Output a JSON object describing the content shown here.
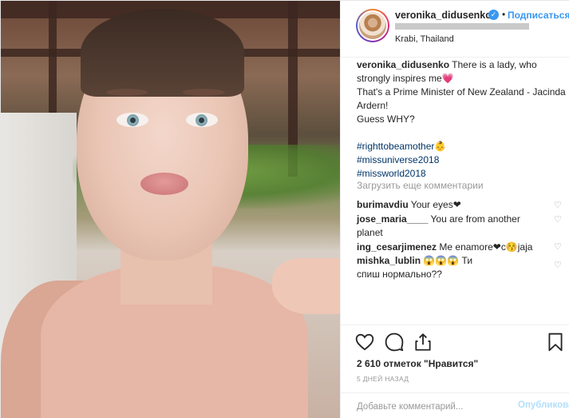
{
  "post": {
    "username": "veronika_didusenko",
    "follow_label": "Подписаться",
    "dot": "•",
    "location": "Krabi, Thailand",
    "caption": {
      "username": "veronika_didusenko",
      "text_line1": " There is a lady, who strongly inspires me💗",
      "text_line2": "That's a Prime Minister of New Zealand - Jacinda Ardern!",
      "text_line3": "Guess WHY?",
      "hashtags": [
        "#righttobeamother👶",
        "#missuniverse2018",
        "#missworld2018"
      ]
    },
    "load_more": "Загрузить еще комментарии",
    "comments": [
      {
        "username": "burimavdiu",
        "text": " Your eyes❤"
      },
      {
        "username": "jose_maria____",
        "text": " You are from another planet"
      },
      {
        "username": "ing_cesarjimenez",
        "text": " Me enamore❤c😚jaja"
      },
      {
        "username": "mishka_lublin",
        "text": " 😱😱😱 Ти спиш нормально??"
      }
    ],
    "likes_text": "2 610 отметок \"Нравится\"",
    "time_ago": "5 ДНЕЙ НАЗАД",
    "add_comment_placeholder": "Добавьте комментарий...",
    "publish_label": "Опубликовать",
    "icons": [
      "heart-icon",
      "comment-icon",
      "share-icon",
      "bookmark-icon",
      "verified-badge-icon"
    ],
    "colors": {
      "link": "#3897f0",
      "hashtag": "#003569",
      "muted": "#999999",
      "verified": "#3897f0"
    }
  }
}
